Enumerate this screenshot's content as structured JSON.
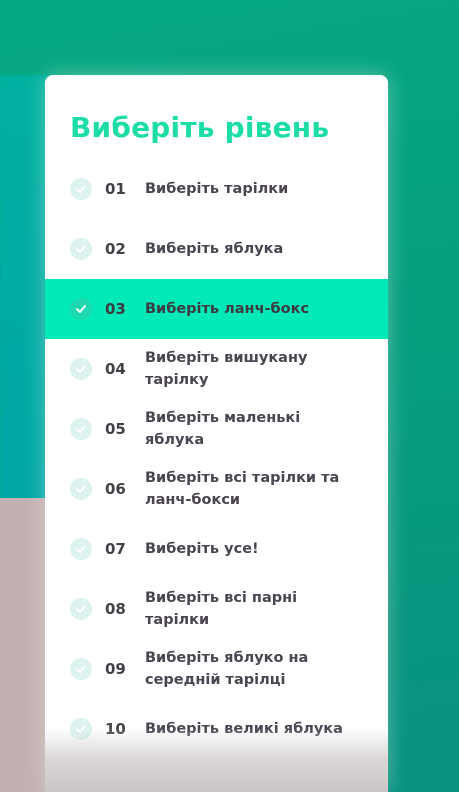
{
  "panel": {
    "title": "Виберіть рівень"
  },
  "levels": [
    {
      "number": "01",
      "label": "Виберіть тарілки",
      "active": false
    },
    {
      "number": "02",
      "label": "Виберіть яблука",
      "active": false
    },
    {
      "number": "03",
      "label": "Виберіть ланч-бокс",
      "active": true
    },
    {
      "number": "04",
      "label": "Виберіть вишукану тарілку",
      "active": false
    },
    {
      "number": "05",
      "label": "Виберіть маленькі яблука",
      "active": false
    },
    {
      "number": "06",
      "label": "Виберіть всі тарілки та ланч-бокси",
      "active": false
    },
    {
      "number": "07",
      "label": "Виберіть усе!",
      "active": false
    },
    {
      "number": "08",
      "label": "Виберіть всі парні тарілки",
      "active": false
    },
    {
      "number": "09",
      "label": "Виберіть яблуко на середній тарілці",
      "active": false
    },
    {
      "number": "10",
      "label": "Виберіть великі яблука",
      "active": false
    }
  ],
  "colors": {
    "accent": "#1ddda6",
    "active_row": "#00e9b7",
    "text": "#4a4550",
    "check_idle": "#dcf3ef",
    "background": "#06a982"
  },
  "icons": {
    "level_status": "check-icon"
  }
}
